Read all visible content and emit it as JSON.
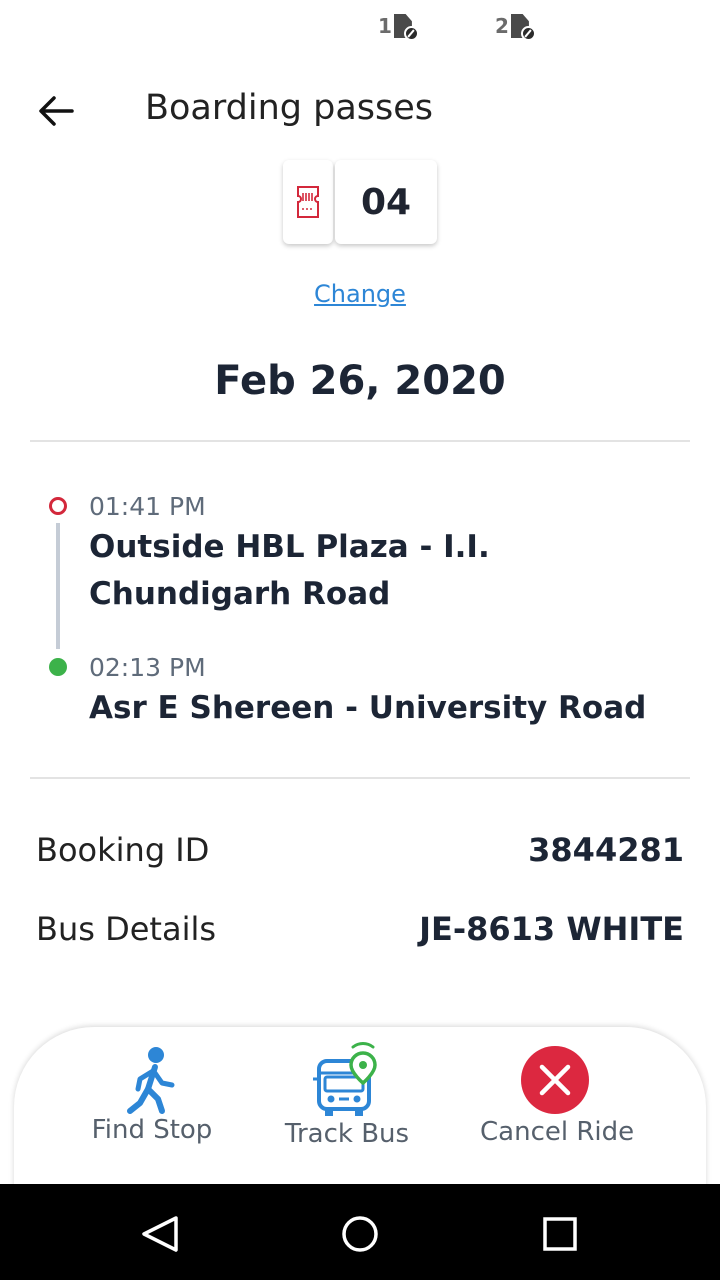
{
  "status_bar": {
    "sim1_label": "1",
    "sim2_label": "2"
  },
  "header": {
    "title": "Boarding passes",
    "back_icon": "arrow-left-icon"
  },
  "ticket_selector": {
    "icon": "ticket-icon",
    "count": "04",
    "change_label": "Change"
  },
  "trip": {
    "date": "Feb 26, 2020",
    "origin": {
      "time": "01:41 PM",
      "stop": "Outside HBL Plaza - I.I. Chundigarh Road",
      "color": "#d3283b"
    },
    "destination": {
      "time": "02:13 PM",
      "stop": "Asr E Shereen - University Road",
      "color": "#3cb24a"
    }
  },
  "details": {
    "booking_label": "Booking ID",
    "booking_value": "3844281",
    "bus_label": "Bus Details",
    "bus_value": "JE-8613 WHITE"
  },
  "actions": {
    "find_stop": {
      "label": "Find Stop",
      "icon": "walking-person-icon",
      "color": "#2d86d6"
    },
    "track_bus": {
      "label": "Track Bus",
      "icon": "bus-location-icon",
      "color": "#2d86d6"
    },
    "cancel_ride": {
      "label": "Cancel Ride",
      "icon": "close-circle-icon",
      "color": "#d3283b"
    }
  },
  "nav": {
    "back": "triangle-back-icon",
    "home": "circle-home-icon",
    "recents": "square-recents-icon"
  }
}
